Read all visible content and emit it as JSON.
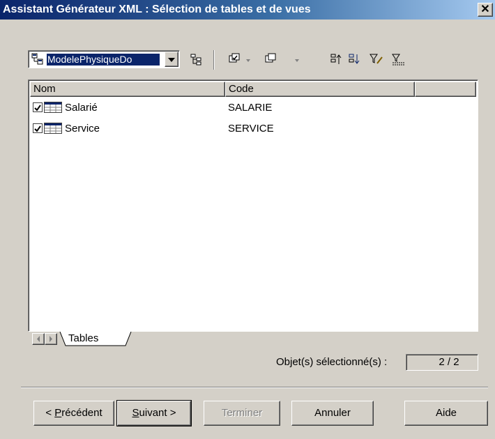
{
  "window": {
    "title": "Assistant Générateur XML : Sélection de tables et de vues",
    "close_icon": "close-icon"
  },
  "toolbar": {
    "model_combo_value": "ModelePhysiqueDo",
    "icons": [
      "model-icon",
      "hierarchy-icon",
      "select-all-icon",
      "deselect-icon",
      "move-up-icon",
      "move-down-icon",
      "filter-edit-icon",
      "filter-clear-icon"
    ]
  },
  "list": {
    "columns": [
      "Nom",
      "Code"
    ],
    "rows": [
      {
        "name": "Salarié",
        "code": "SALARIE",
        "checked": true
      },
      {
        "name": "Service",
        "code": "SERVICE",
        "checked": true
      }
    ]
  },
  "tabs": {
    "active": "Tables"
  },
  "status": {
    "label": "Objet(s) sélectionné(s) :",
    "value": "2 / 2"
  },
  "buttons": {
    "previous_pre": "< ",
    "previous_underline": "P",
    "previous_post": "récédent",
    "next_underline": "S",
    "next_post": "uivant >",
    "finish": "Terminer",
    "cancel": "Annuler",
    "help": "Aide"
  },
  "colors": {
    "titlebar_start": "#0a246a",
    "titlebar_end": "#a6caf0",
    "dialog_bg": "#d4d0c8",
    "selection": "#0a246a"
  }
}
